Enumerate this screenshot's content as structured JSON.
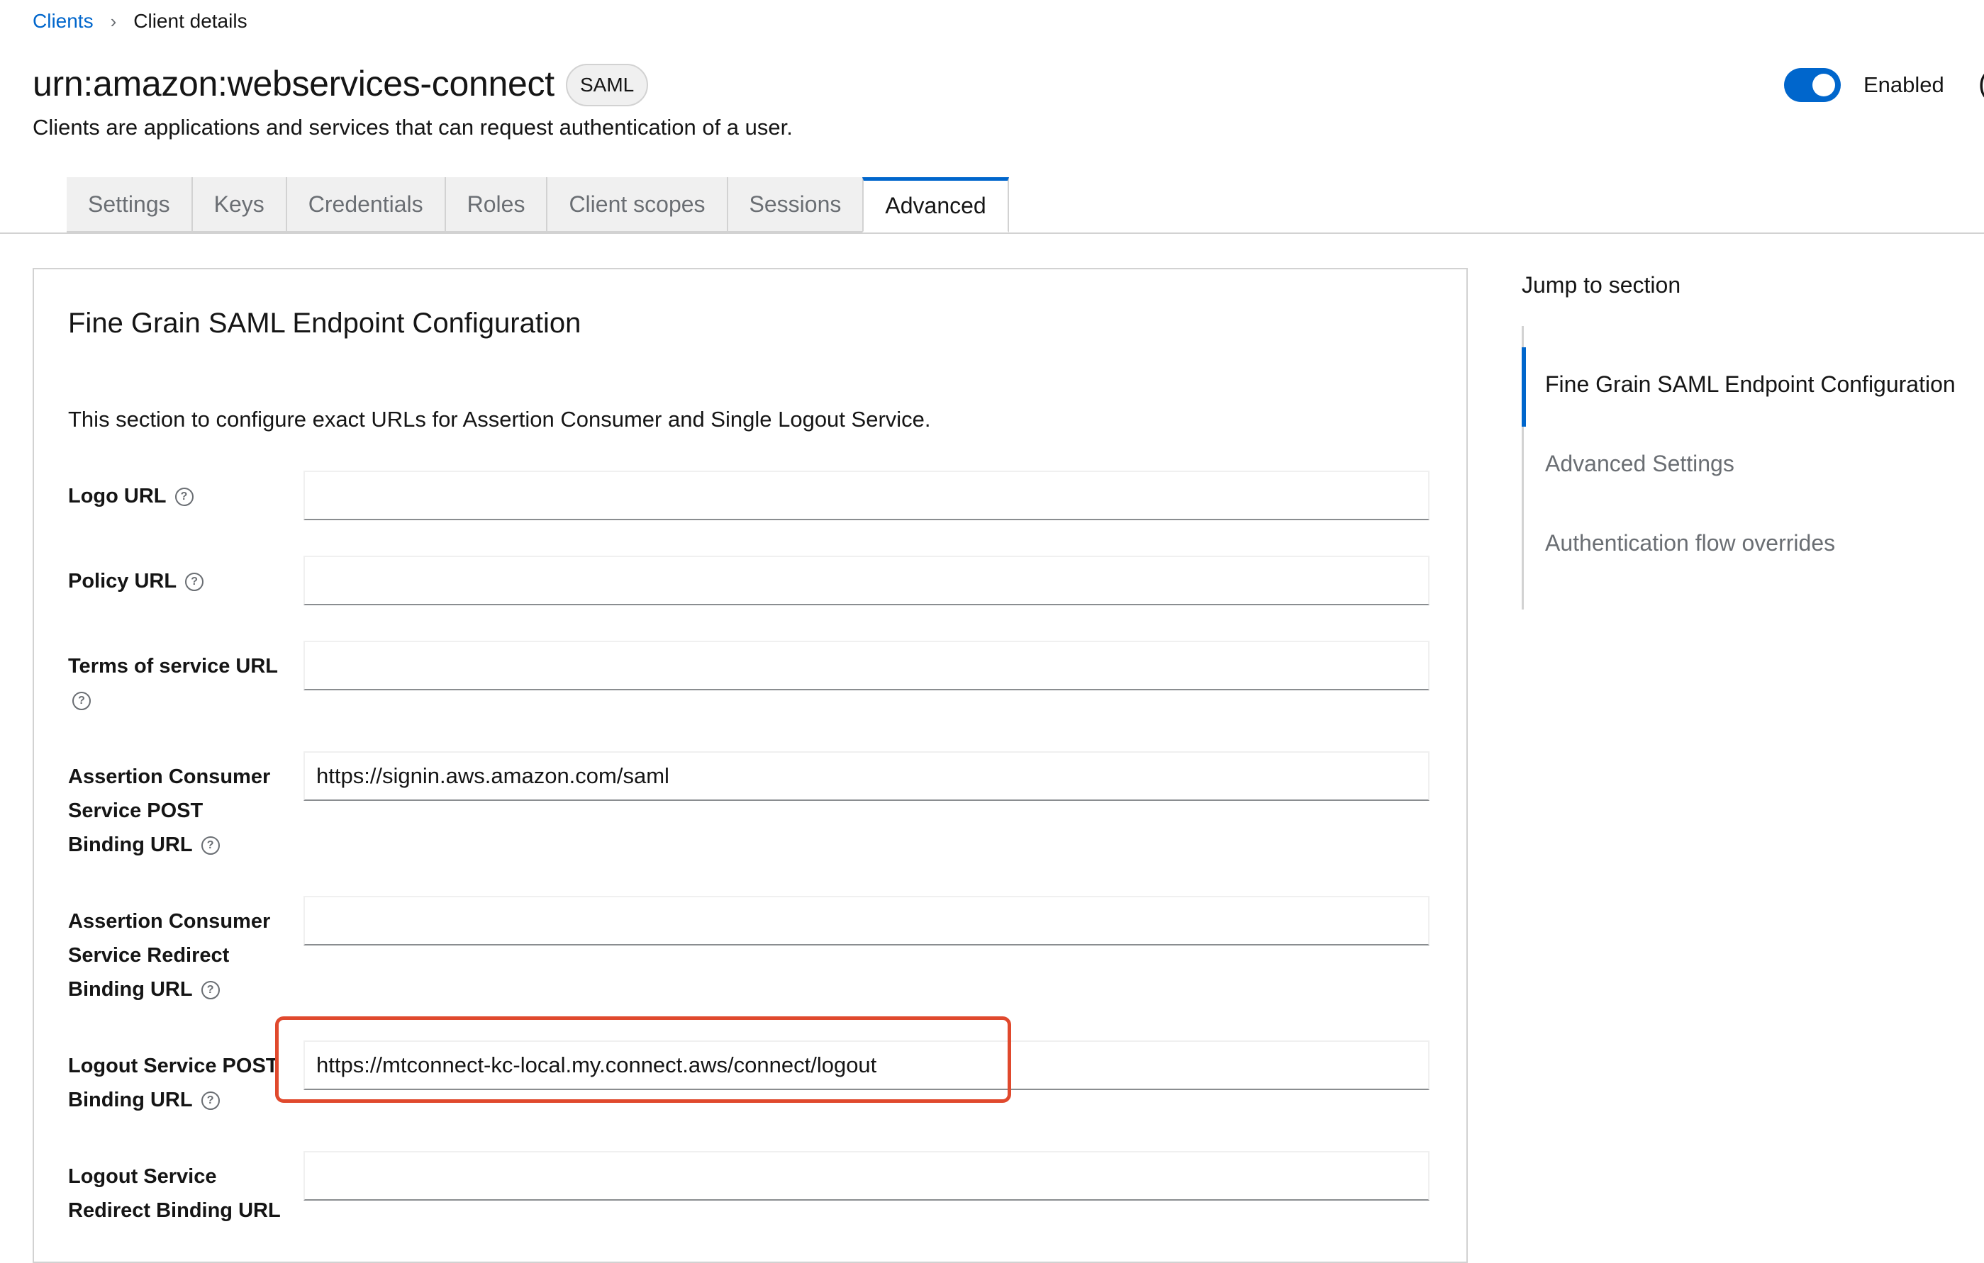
{
  "breadcrumb": {
    "link": "Clients",
    "current": "Client details"
  },
  "header": {
    "title": "urn:amazon:webservices-connect",
    "badge": "SAML",
    "subtitle": "Clients are applications and services that can request authentication of a user.",
    "toggle_label": "Enabled",
    "toggle_on": true,
    "edge_char": "("
  },
  "tabs": [
    {
      "label": "Settings"
    },
    {
      "label": "Keys"
    },
    {
      "label": "Credentials"
    },
    {
      "label": "Roles"
    },
    {
      "label": "Client scopes"
    },
    {
      "label": "Sessions"
    },
    {
      "label": "Advanced"
    }
  ],
  "active_tab": "Advanced",
  "section": {
    "title": "Fine Grain SAML Endpoint Configuration",
    "description": "This section to configure exact URLs for Assertion Consumer and Single Logout Service.",
    "fields": [
      {
        "label": "Logo URL",
        "value": ""
      },
      {
        "label": "Policy URL",
        "value": ""
      },
      {
        "label": "Terms of service URL",
        "value": ""
      },
      {
        "label": "Assertion Consumer Service POST Binding URL",
        "value": "https://signin.aws.amazon.com/saml"
      },
      {
        "label": "Assertion Consumer Service Redirect Binding URL",
        "value": ""
      },
      {
        "label": "Logout Service POST Binding URL",
        "value": "https://mtconnect-kc-local.my.connect.aws/connect/logout"
      },
      {
        "label": "Logout Service Redirect Binding URL",
        "value": ""
      }
    ]
  },
  "jump": {
    "title": "Jump to section",
    "items": [
      {
        "label": "Fine Grain SAML Endpoint Configuration"
      },
      {
        "label": "Advanced Settings"
      },
      {
        "label": "Authentication flow overrides"
      }
    ]
  },
  "colors": {
    "accent": "#0066cc",
    "highlight": "#e0492d"
  },
  "icons": {
    "breadcrumb_separator": "chevron-right-icon",
    "help": "question-circle-icon"
  }
}
